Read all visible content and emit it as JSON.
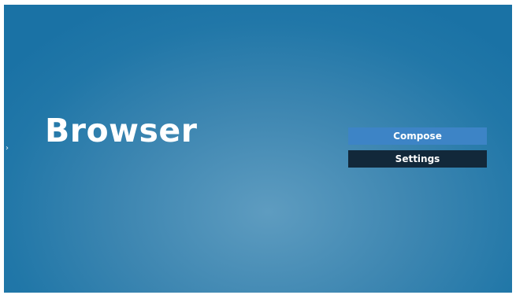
{
  "app": {
    "title": "Browser"
  },
  "menu": {
    "items": [
      {
        "label": "Compose",
        "state": "selected"
      },
      {
        "label": "Settings",
        "state": "default"
      }
    ]
  },
  "nav": {
    "left_icon": "chevron-right-icon",
    "right_icon": "chevron-left-icon",
    "left_glyph": "›",
    "right_glyph": "‹"
  },
  "colors": {
    "background": "#2177a8",
    "compose_highlight": "#3d84c6",
    "settings_bg": "#12283a",
    "text": "#ffffff"
  }
}
